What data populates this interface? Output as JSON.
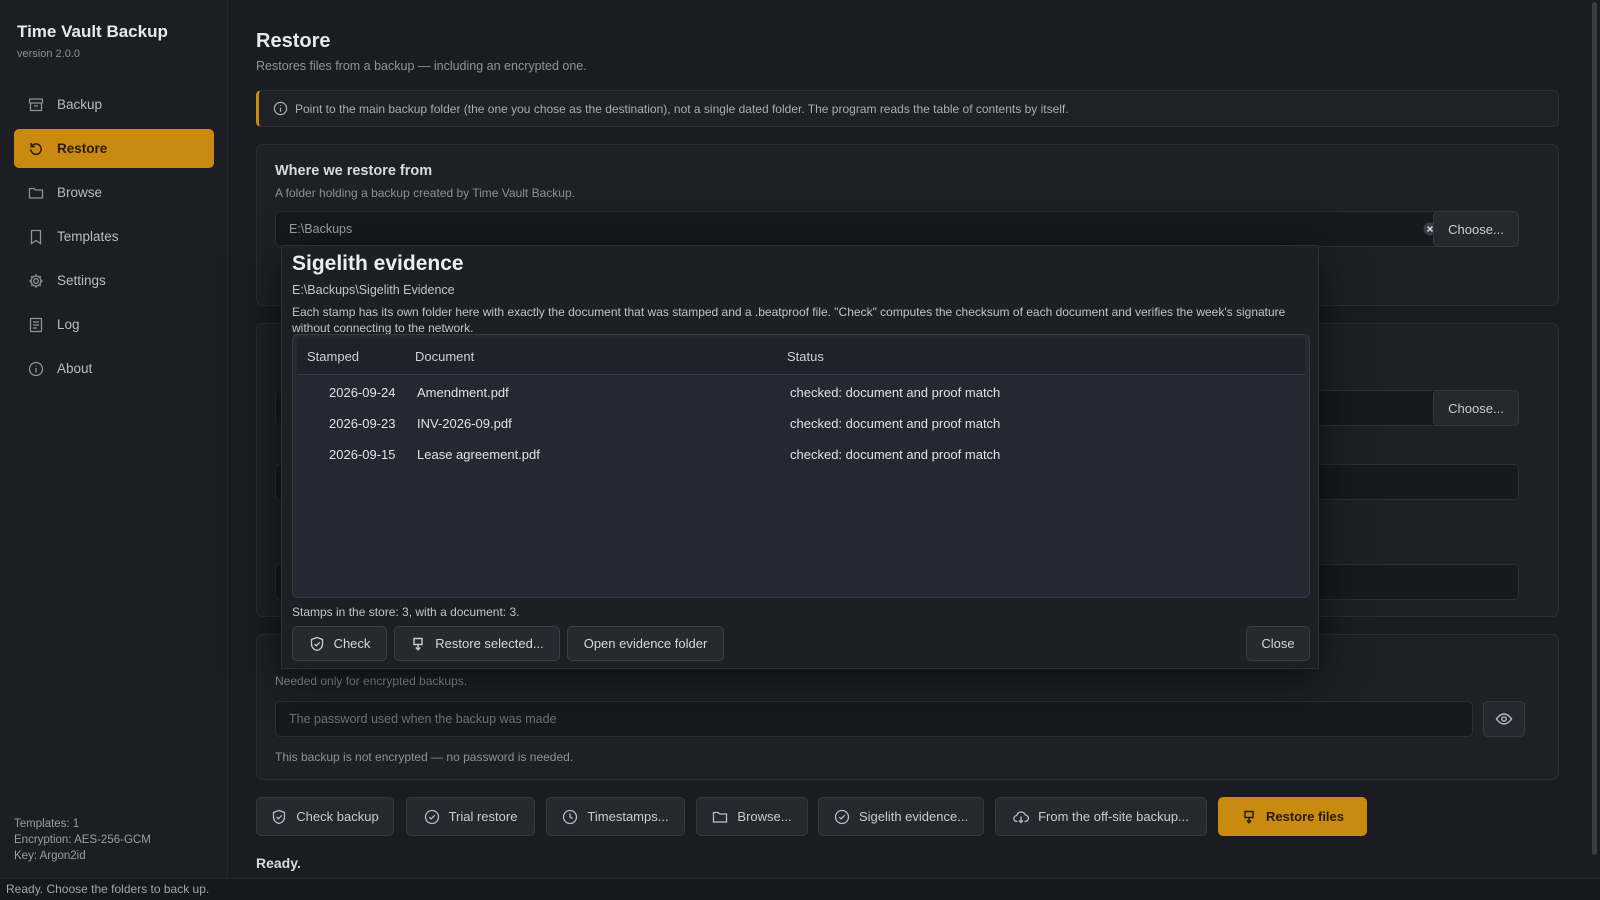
{
  "app": {
    "title": "Time Vault Backup",
    "version": "version 2.0.0"
  },
  "sidebar": {
    "items": [
      {
        "label": "Backup",
        "icon": "archive-icon"
      },
      {
        "label": "Restore",
        "icon": "restore-icon",
        "active": true
      },
      {
        "label": "Browse",
        "icon": "folder-icon"
      },
      {
        "label": "Templates",
        "icon": "bookmark-icon"
      },
      {
        "label": "Settings",
        "icon": "gear-icon"
      },
      {
        "label": "Log",
        "icon": "log-icon"
      },
      {
        "label": "About",
        "icon": "info-icon"
      }
    ],
    "footer": {
      "templates": "Templates: 1",
      "encryption": "Encryption: AES-256-GCM",
      "key": "Key: Argon2id"
    }
  },
  "main": {
    "title": "Restore",
    "subtitle": "Restores files from a backup — including an encrypted one.",
    "info": "Point to the main backup folder (the one you chose as the destination), not a single dated folder. The program reads the table of contents by itself.",
    "source": {
      "title": "Where we restore from",
      "subtitle": "A folder holding a backup created by Time Vault Backup.",
      "value": "E:\\Backups",
      "choose_label": "Choose..."
    },
    "target": {
      "choose_label": "Choose..."
    },
    "password": {
      "subtitle": "Needed only for encrypted backups.",
      "placeholder": "The password used when the backup was made",
      "note": "This backup is not encrypted — no password is needed."
    },
    "actions": {
      "check_backup": "Check backup",
      "trial_restore": "Trial restore",
      "timestamps": "Timestamps...",
      "browse": "Browse...",
      "sigelith": "Sigelith evidence...",
      "offsite": "From the off-site backup...",
      "restore": "Restore files"
    },
    "ready": "Ready."
  },
  "statusbar": "Ready. Choose the folders to back up.",
  "dialog": {
    "title": "Sigelith evidence",
    "path": "E:\\Backups\\Sigelith Evidence",
    "description": "Each stamp has its own folder here with exactly the document that was stamped and a .beatproof file. \"Check\" computes the checksum of each document and verifies the week's signature without connecting to the network.",
    "columns": {
      "stamped": "Stamped",
      "document": "Document",
      "status": "Status"
    },
    "rows": [
      {
        "stamped": "2026-09-24",
        "document": "Amendment.pdf",
        "status": "checked: document and proof match"
      },
      {
        "stamped": "2026-09-23",
        "document": "INV-2026-09.pdf",
        "status": "checked: document and proof match"
      },
      {
        "stamped": "2026-09-15",
        "document": "Lease agreement.pdf",
        "status": "checked: document and proof match"
      }
    ],
    "count": "Stamps in the store: 3, with a document: 3.",
    "buttons": {
      "check": "Check",
      "restore_selected": "Restore selected...",
      "open_folder": "Open evidence folder",
      "close": "Close"
    }
  },
  "colors": {
    "accent": "#c98a10",
    "background": "#1a1c22",
    "panel": "#1e2026"
  }
}
